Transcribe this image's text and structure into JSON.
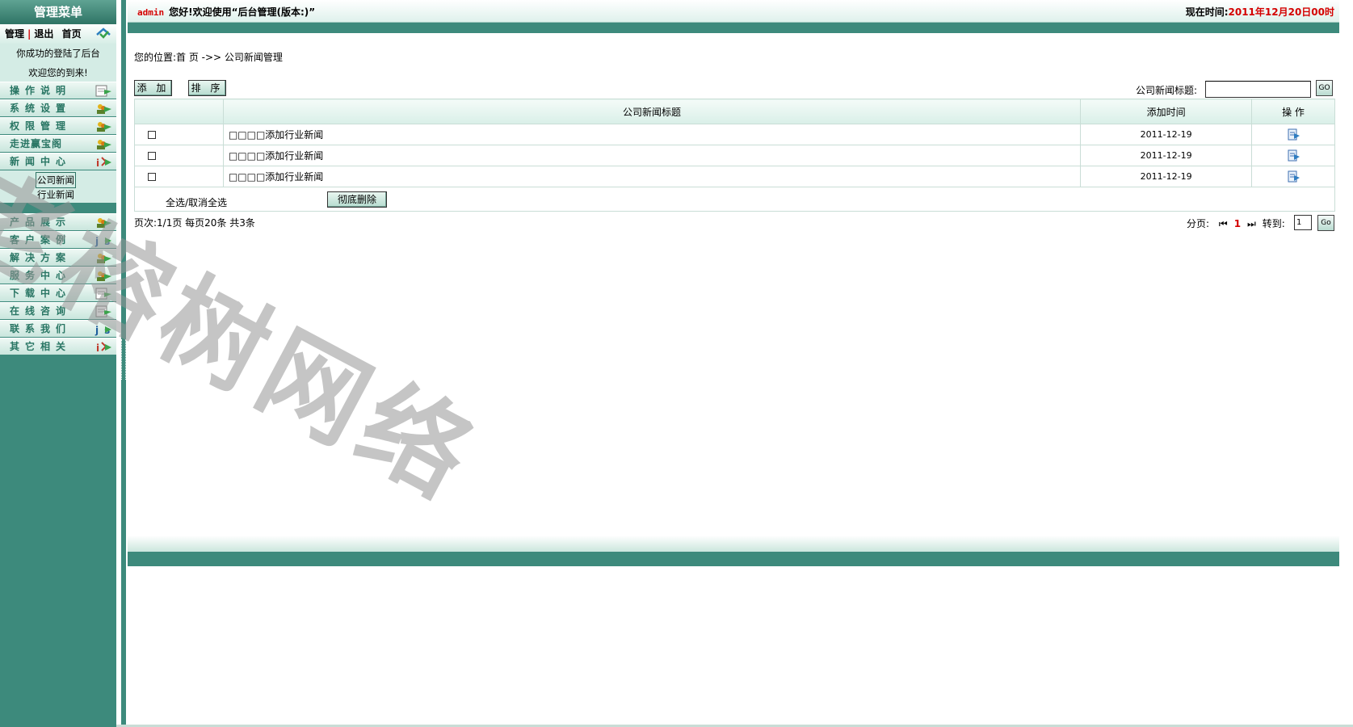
{
  "sidebar": {
    "title": "管理菜单",
    "links": [
      "管理",
      "退出",
      "首页"
    ],
    "link_separator": "|",
    "welcome_line1": "你成功的登陆了后台",
    "welcome_line2": "欢迎您的到来!",
    "menu_top": [
      {
        "label": "操作说明",
        "icon": "notepad-icon"
      },
      {
        "label": "系统设置",
        "icon": "users-icon"
      },
      {
        "label": "权限管理",
        "icon": "users-icon"
      },
      {
        "label": "走进赢宝阁",
        "icon": "users-icon"
      },
      {
        "label": "新闻中心",
        "icon": "info-icon"
      }
    ],
    "submenu": [
      {
        "label": "公司新闻",
        "active": true
      },
      {
        "label": "行业新闻",
        "active": false
      }
    ],
    "menu_bottom": [
      {
        "label": "产品展示",
        "icon": "users-icon"
      },
      {
        "label": "客户案例",
        "icon": "js-icon"
      },
      {
        "label": "解决方案",
        "icon": "users-icon"
      },
      {
        "label": "服务中心",
        "icon": "users-icon"
      },
      {
        "label": "下载中心",
        "icon": "notepad-icon"
      },
      {
        "label": "在线咨询",
        "icon": "notepad-icon"
      },
      {
        "label": "联系我们",
        "icon": "js-icon"
      },
      {
        "label": "其它相关",
        "icon": "info-icon"
      }
    ]
  },
  "topbar": {
    "user": "admin",
    "greeting": "您好!欢迎使用“后台管理(版本:)”",
    "time_label": "现在时间:",
    "time_value": "2011年12月20日00时"
  },
  "breadcrumb": "您的位置:首 页 ->> 公司新闻管理",
  "toolbar": {
    "add_label": "添 加",
    "sort_label": "排 序",
    "search_label": "公司新闻标题:",
    "search_value": "",
    "go_label": "GO"
  },
  "table": {
    "headers": [
      "",
      "公司新闻标题",
      "添加时间",
      "操 作"
    ],
    "rows": [
      {
        "title": "□□□□添加行业新闻",
        "date": "2011-12-19"
      },
      {
        "title": "□□□□添加行业新闻",
        "date": "2011-12-19"
      },
      {
        "title": "□□□□添加行业新闻",
        "date": "2011-12-19"
      }
    ]
  },
  "select": {
    "select_all_label": "全选/取消全选",
    "delete_label": "彻底删除"
  },
  "pager": {
    "summary": "页次:1/1页 每页20条 共3条",
    "page_label": "分页:",
    "current_page": "1",
    "goto_label": "转到:",
    "goto_value": "1",
    "go_label": "Go"
  },
  "watermark": "老榕树网络",
  "colors": {
    "theme": "#3d8a7c",
    "accent_red": "#d40000",
    "header_bg": "#d9efe8"
  }
}
